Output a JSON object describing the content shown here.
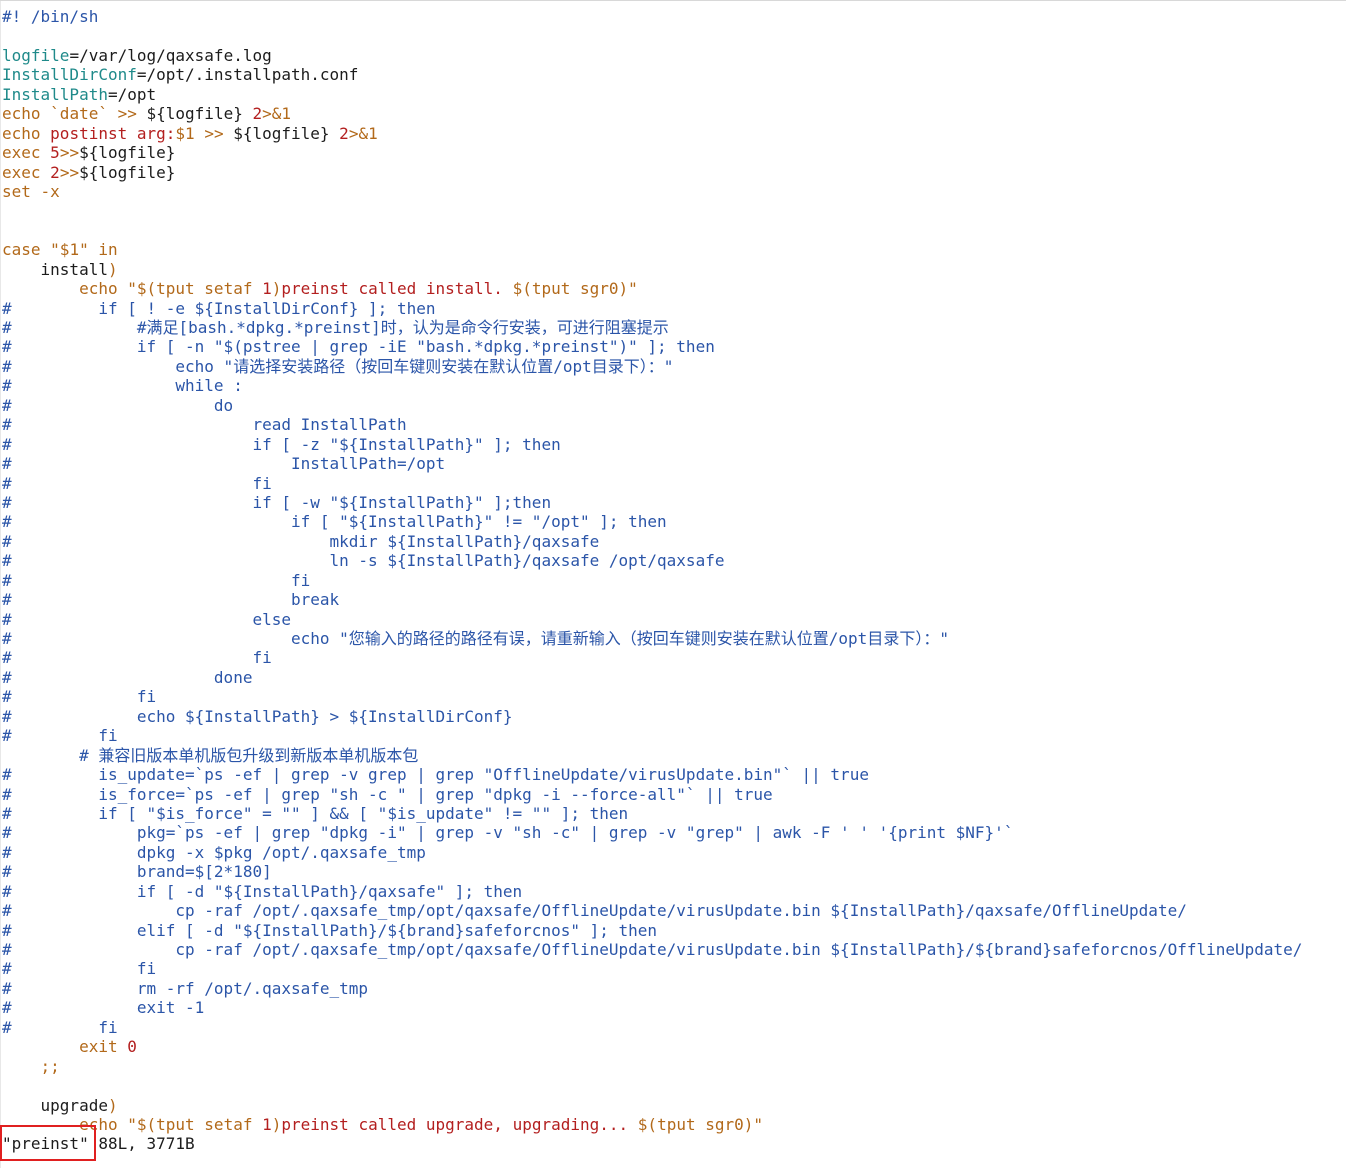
{
  "editor": {
    "file_name": "preinst",
    "lines": [
      [
        [
          "cmt",
          "#! /bin/sh"
        ]
      ],
      [],
      [
        [
          "var",
          "logfile"
        ],
        [
          "txt",
          "=/var/log/qaxsafe.log"
        ]
      ],
      [
        [
          "var",
          "InstallDirConf"
        ],
        [
          "txt",
          "=/opt/.installpath.conf"
        ]
      ],
      [
        [
          "var",
          "InstallPath"
        ],
        [
          "txt",
          "=/opt"
        ]
      ],
      [
        [
          "kw",
          "echo"
        ],
        [
          "txt",
          " "
        ],
        [
          "kw",
          "`date`"
        ],
        [
          "txt",
          " "
        ],
        [
          "kw",
          ">>"
        ],
        [
          "txt",
          " ${logfile} "
        ],
        [
          "str",
          "2"
        ],
        [
          "kw",
          ">&1"
        ]
      ],
      [
        [
          "kw",
          "echo"
        ],
        [
          "txt",
          " "
        ],
        [
          "str",
          "postinst arg:"
        ],
        [
          "kw",
          "$1"
        ],
        [
          "txt",
          " "
        ],
        [
          "kw",
          ">>"
        ],
        [
          "txt",
          " ${logfile} "
        ],
        [
          "str",
          "2"
        ],
        [
          "kw",
          ">&1"
        ]
      ],
      [
        [
          "kw",
          "exec"
        ],
        [
          "txt",
          " "
        ],
        [
          "str",
          "5"
        ],
        [
          "kw",
          ">>"
        ],
        [
          "txt",
          "${logfile}"
        ]
      ],
      [
        [
          "kw",
          "exec"
        ],
        [
          "txt",
          " "
        ],
        [
          "str",
          "2"
        ],
        [
          "kw",
          ">>"
        ],
        [
          "txt",
          "${logfile}"
        ]
      ],
      [
        [
          "kw",
          "set"
        ],
        [
          "txt",
          " "
        ],
        [
          "kw",
          "-x"
        ]
      ],
      [],
      [],
      [
        [
          "kw",
          "case"
        ],
        [
          "txt",
          " "
        ],
        [
          "kw",
          "\"$1\""
        ],
        [
          "txt",
          " "
        ],
        [
          "kw",
          "in"
        ]
      ],
      [
        [
          "txt",
          "    install"
        ],
        [
          "kw",
          ")"
        ]
      ],
      [
        [
          "txt",
          "        "
        ],
        [
          "kw",
          "echo"
        ],
        [
          "txt",
          " "
        ],
        [
          "kw",
          "\"$(tput setaf "
        ],
        [
          "str",
          "1"
        ],
        [
          "kw",
          ")"
        ],
        [
          "str",
          "preinst called install. "
        ],
        [
          "kw",
          "$(tput sgr0)\""
        ]
      ],
      [
        [
          "cmt",
          "#         if [ ! -e ${InstallDirConf} ]; then"
        ]
      ],
      [
        [
          "cmt",
          "#             #满足[bash.*dpkg.*preinst]时，认为是命令行安装，可进行阻塞提示"
        ]
      ],
      [
        [
          "cmt",
          "#             if [ -n \"$(pstree | grep -iE \"bash.*dpkg.*preinst\")\" ]; then"
        ]
      ],
      [
        [
          "cmt",
          "#                 echo \"请选择安装路径（按回车键则安装在默认位置/opt目录下）：\""
        ]
      ],
      [
        [
          "cmt",
          "#                 while :"
        ]
      ],
      [
        [
          "cmt",
          "#                     do"
        ]
      ],
      [
        [
          "cmt",
          "#                         read InstallPath"
        ]
      ],
      [
        [
          "cmt",
          "#                         if [ -z \"${InstallPath}\" ]; then"
        ]
      ],
      [
        [
          "cmt",
          "#                             InstallPath=/opt"
        ]
      ],
      [
        [
          "cmt",
          "#                         fi"
        ]
      ],
      [
        [
          "cmt",
          "#                         if [ -w \"${InstallPath}\" ];then"
        ]
      ],
      [
        [
          "cmt",
          "#                             if [ \"${InstallPath}\" != \"/opt\" ]; then"
        ]
      ],
      [
        [
          "cmt",
          "#                                 mkdir ${InstallPath}/qaxsafe"
        ]
      ],
      [
        [
          "cmt",
          "#                                 ln -s ${InstallPath}/qaxsafe /opt/qaxsafe"
        ]
      ],
      [
        [
          "cmt",
          "#                             fi"
        ]
      ],
      [
        [
          "cmt",
          "#                             break"
        ]
      ],
      [
        [
          "cmt",
          "#                         else"
        ]
      ],
      [
        [
          "cmt",
          "#                             echo \"您输入的路径的路径有误，请重新输入（按回车键则安装在默认位置/opt目录下）：\""
        ]
      ],
      [
        [
          "cmt",
          "#                         fi"
        ]
      ],
      [
        [
          "cmt",
          "#                     done"
        ]
      ],
      [
        [
          "cmt",
          "#             fi"
        ]
      ],
      [
        [
          "cmt",
          "#             echo ${InstallPath} > ${InstallDirConf}"
        ]
      ],
      [
        [
          "cmt",
          "#         fi"
        ]
      ],
      [
        [
          "cmt",
          "        # 兼容旧版本单机版包升级到新版本单机版本包"
        ]
      ],
      [
        [
          "cmt",
          "#         is_update=`ps -ef | grep -v grep | grep \"OfflineUpdate/virusUpdate.bin\"` || true"
        ]
      ],
      [
        [
          "cmt",
          "#         is_force=`ps -ef | grep \"sh -c \" | grep \"dpkg -i --force-all\"` || true"
        ]
      ],
      [
        [
          "cmt",
          "#         if [ \"$is_force\" = \"\" ] && [ \"$is_update\" != \"\" ]; then"
        ]
      ],
      [
        [
          "cmt",
          "#             pkg=`ps -ef | grep \"dpkg -i\" | grep -v \"sh -c\" | grep -v \"grep\" | awk -F ' ' '{print $NF}'`"
        ]
      ],
      [
        [
          "cmt",
          "#             dpkg -x $pkg /opt/.qaxsafe_tmp"
        ]
      ],
      [
        [
          "cmt",
          "#             brand=$[2*180]"
        ]
      ],
      [
        [
          "cmt",
          "#             if [ -d \"${InstallPath}/qaxsafe\" ]; then"
        ]
      ],
      [
        [
          "cmt",
          "#                 cp -raf /opt/.qaxsafe_tmp/opt/qaxsafe/OfflineUpdate/virusUpdate.bin ${InstallPath}/qaxsafe/OfflineUpdate/"
        ]
      ],
      [
        [
          "cmt",
          "#             elif [ -d \"${InstallPath}/${brand}safeforcnos\" ]; then"
        ]
      ],
      [
        [
          "cmt",
          "#                 cp -raf /opt/.qaxsafe_tmp/opt/qaxsafe/OfflineUpdate/virusUpdate.bin ${InstallPath}/${brand}safeforcnos/OfflineUpdate/"
        ]
      ],
      [
        [
          "cmt",
          "#             fi"
        ]
      ],
      [
        [
          "cmt",
          "#             rm -rf /opt/.qaxsafe_tmp"
        ]
      ],
      [
        [
          "cmt",
          "#             exit -1"
        ]
      ],
      [
        [
          "cmt",
          "#         fi"
        ]
      ],
      [
        [
          "txt",
          "        "
        ],
        [
          "kw",
          "exit"
        ],
        [
          "txt",
          " "
        ],
        [
          "str",
          "0"
        ]
      ],
      [
        [
          "txt",
          "    "
        ],
        [
          "kw",
          ";;"
        ]
      ],
      [],
      [
        [
          "txt",
          "    upgrade"
        ],
        [
          "kw",
          ")"
        ]
      ],
      [
        [
          "txt",
          "        "
        ],
        [
          "kw",
          "echo"
        ],
        [
          "txt",
          " "
        ],
        [
          "kw",
          "\"$(tput setaf "
        ],
        [
          "str",
          "1"
        ],
        [
          "kw",
          ")"
        ],
        [
          "str",
          "preinst called upgrade, upgrading... "
        ],
        [
          "kw",
          "$(tput sgr0)\""
        ]
      ]
    ]
  },
  "statusline": {
    "file_label": "\"preinst\"",
    "info": " 88L, 3771B"
  },
  "colors": {
    "comment": "#2b55a8",
    "keyword": "#b2691a",
    "string": "#b31f1f",
    "variable": "#1f8a8a",
    "highlight_box": "#e02020"
  }
}
